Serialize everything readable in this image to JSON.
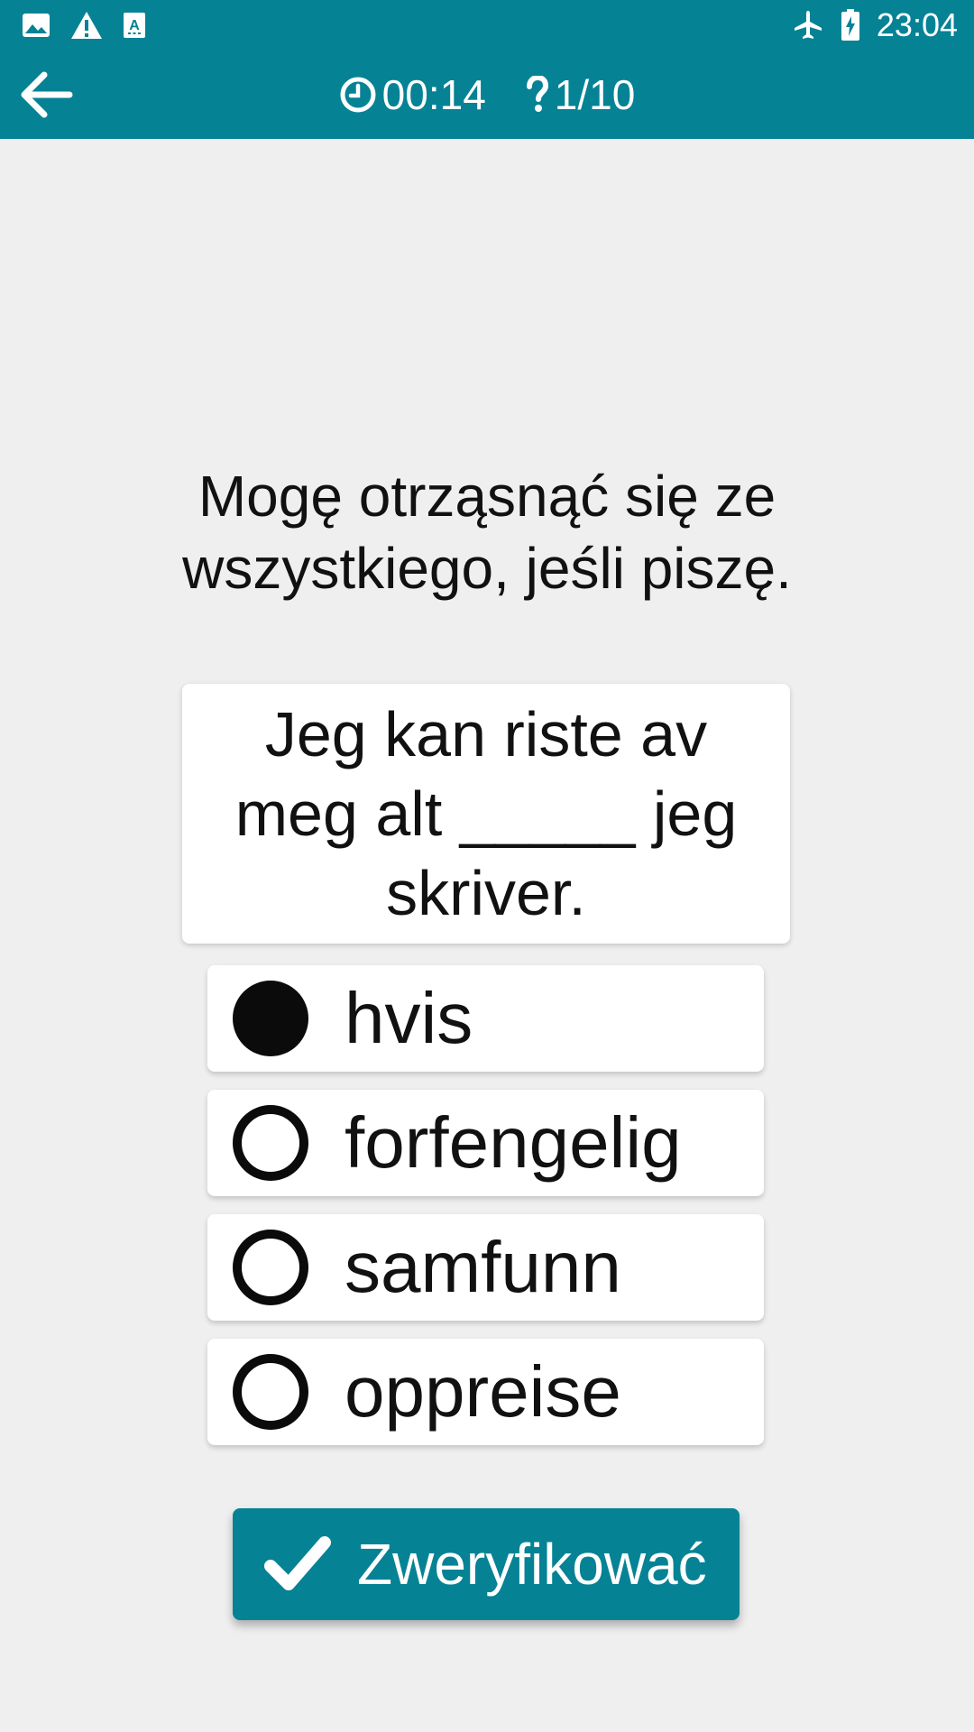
{
  "status_bar": {
    "time": "23:04",
    "left_icons": [
      "image-icon",
      "warning-icon",
      "text-icon"
    ],
    "right_icons": [
      "airplane-icon",
      "battery-icon"
    ]
  },
  "toolbar": {
    "timer": "00:14",
    "progress": "1/10",
    "icons": [
      "back-arrow-icon",
      "clock-icon",
      "question-mark-icon"
    ]
  },
  "quiz": {
    "prompt": "Mogę otrząsnąć się ze wszystkiego, jeśli piszę.",
    "sentence": "Jeg kan riste av meg alt _____ jeg skriver.",
    "options": [
      {
        "label": "hvis",
        "selected": true
      },
      {
        "label": "forfengelig",
        "selected": false
      },
      {
        "label": "samfunn",
        "selected": false
      },
      {
        "label": "oppreise",
        "selected": false
      }
    ],
    "verify_label": "Zweryfikować"
  },
  "colors": {
    "accent": "#068295",
    "background": "#efefef",
    "card": "#ffffff"
  }
}
